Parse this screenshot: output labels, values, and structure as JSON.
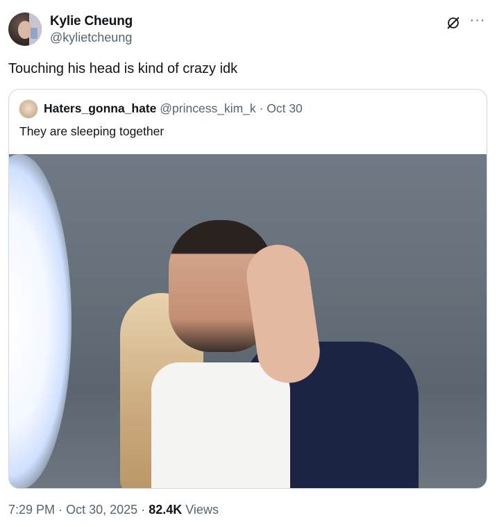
{
  "tweet": {
    "author_name": "Kylie Cheung",
    "author_handle": "@kylietcheung",
    "text": "Touching his head is kind of crazy idk",
    "time": "7:29 PM",
    "date": "Oct 30, 2025",
    "separator": "·",
    "views_count": "82.4K",
    "views_label": "Views"
  },
  "quoted": {
    "author_name": "Haters_gonna_hate",
    "author_handle": "@princess_kim_k",
    "separator": "·",
    "date": "Oct 30",
    "text": "They are sleeping together"
  },
  "icons": {
    "grok": "grok-icon",
    "more": "more-icon"
  },
  "colors": {
    "text": "#0f1419",
    "secondary": "#536471",
    "border": "#cfd9de"
  }
}
